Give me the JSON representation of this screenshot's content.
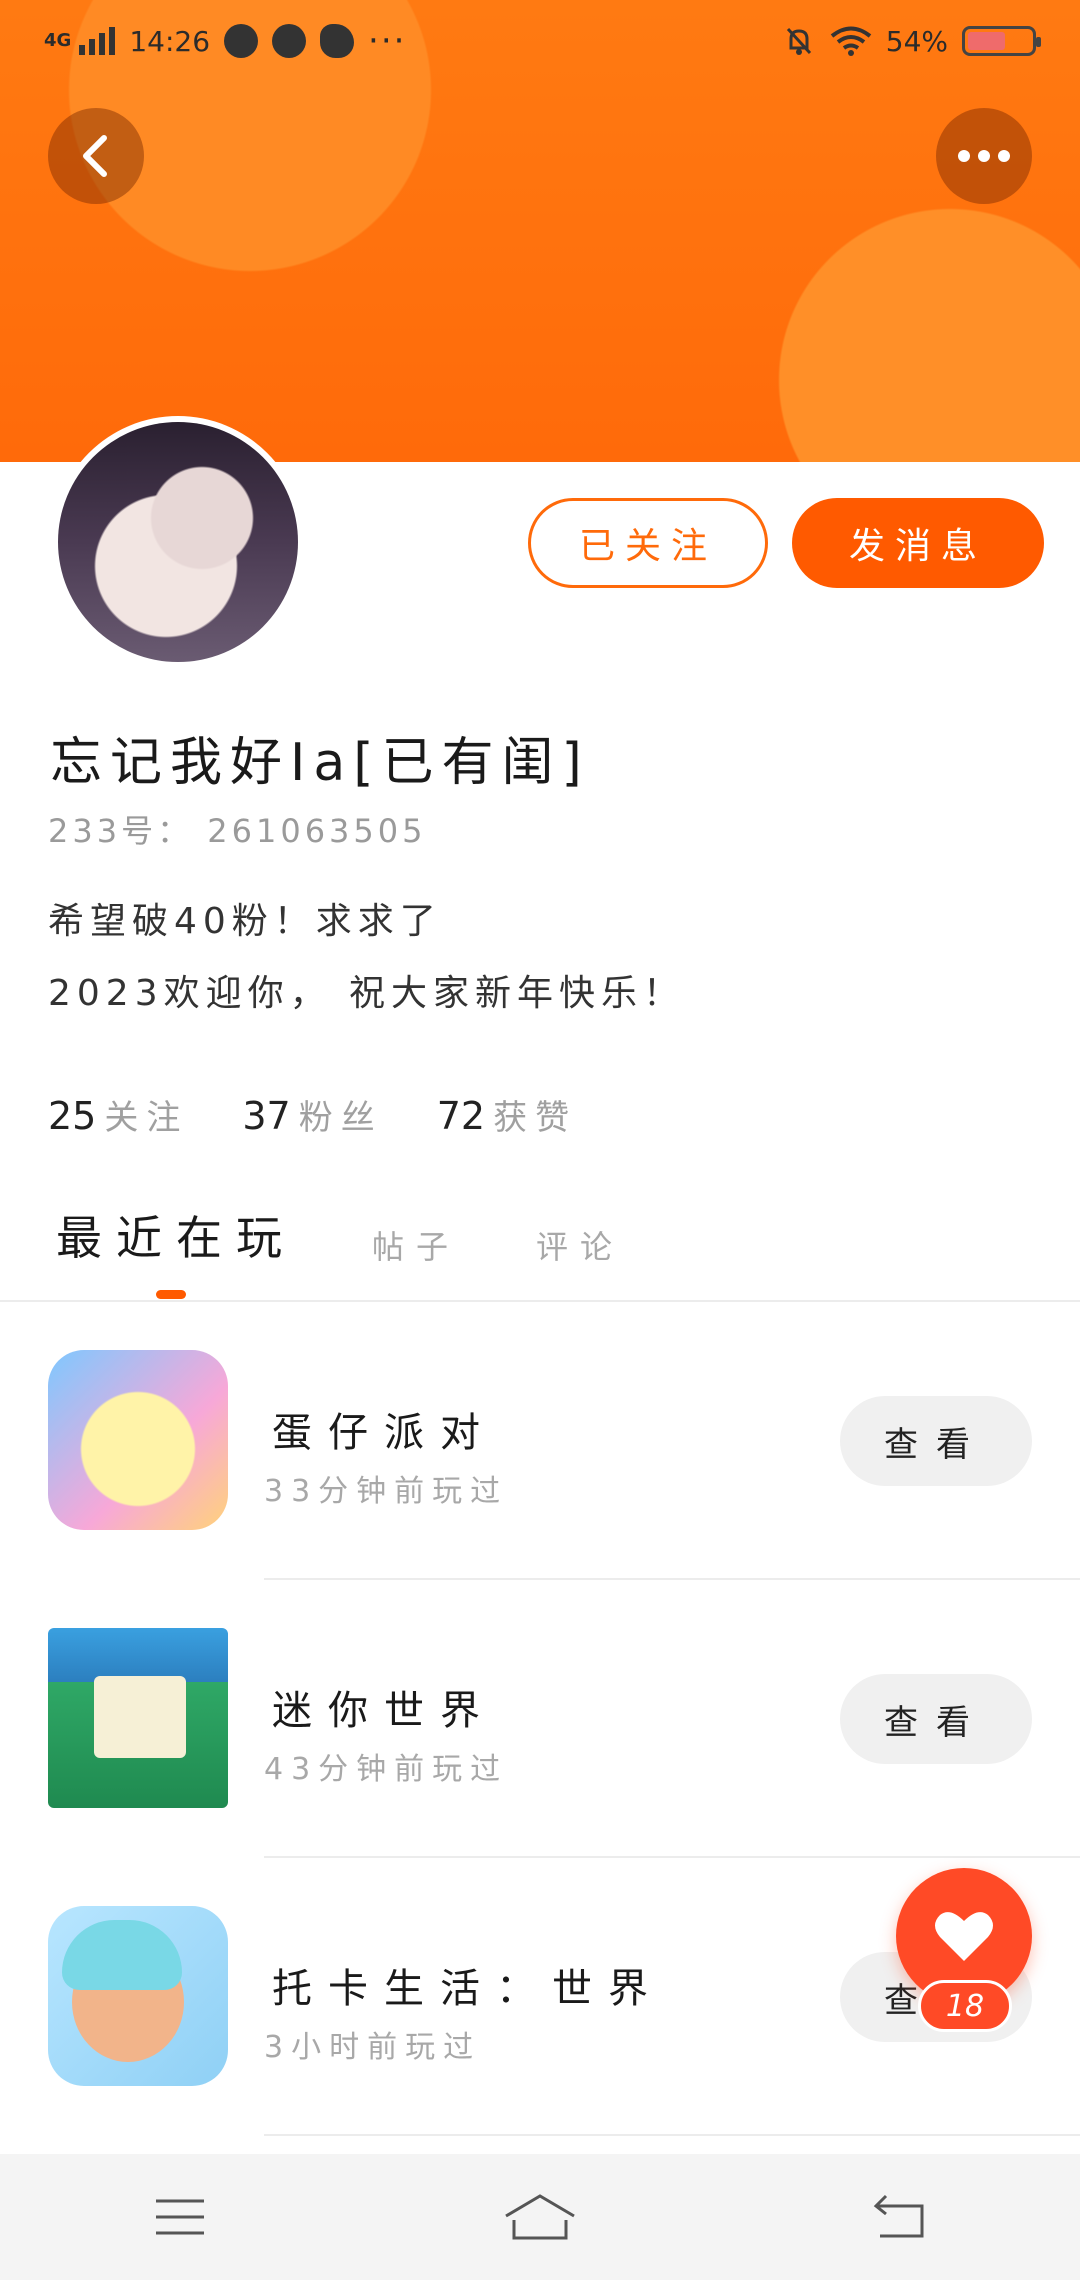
{
  "status_bar": {
    "network": "4G",
    "time": "14:26",
    "battery_text": "54%",
    "battery_level": 0.54,
    "more_indicator": "···"
  },
  "header": {
    "back_icon": "chevron-left-icon",
    "more_icon": "more-dots-icon",
    "banner_color": "#ff6a0a"
  },
  "profile": {
    "follow_button": "已关注",
    "message_button": "发消息",
    "username": "忘记我好Ia[已有闺]",
    "uid": "233号： 261063505",
    "bio_line1": "希望破40粉！求求了",
    "bio_line2": "2023欢迎你， 祝大家新年快乐！"
  },
  "stats": [
    {
      "num": "25",
      "label": "关注"
    },
    {
      "num": "37",
      "label": "粉丝"
    },
    {
      "num": "72",
      "label": "获赞"
    }
  ],
  "tabs": [
    "最近在玩",
    "帖子",
    "评论"
  ],
  "games": [
    {
      "title": "蛋仔派对",
      "time": "33分钟前玩过",
      "button": "查看"
    },
    {
      "title": "迷你世界",
      "time": "43分钟前玩过",
      "button": "查看"
    },
    {
      "title": "托卡生活：世界",
      "time": "3小时前玩过",
      "button": "查看"
    }
  ],
  "like_fab": {
    "icon": "heart-icon",
    "count": "18"
  },
  "accent_color": "#ff5a00"
}
